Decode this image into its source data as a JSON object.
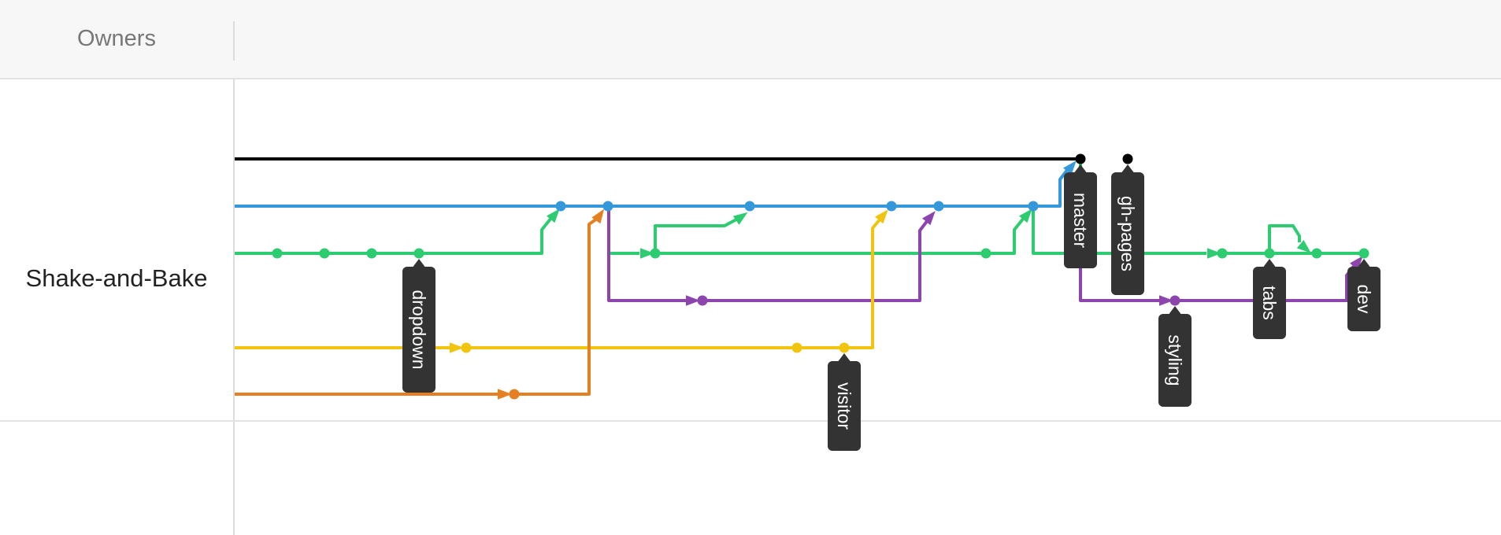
{
  "header": {
    "title": "Owners"
  },
  "repo": {
    "name": "Shake-and-Bake"
  },
  "colors": {
    "black": "#000000",
    "blue": "#3498db",
    "green": "#2ecc71",
    "purple": "#8e44ad",
    "yellow": "#f1c40f",
    "orange": "#e67e22",
    "tag_bg": "#333333"
  },
  "branch_tags": [
    {
      "label": "dropdown",
      "lane": "green"
    },
    {
      "label": "visitor",
      "lane": "yellow"
    },
    {
      "label": "master",
      "lane": "black"
    },
    {
      "label": "gh-pages",
      "lane": "black"
    },
    {
      "label": "styling",
      "lane": "purple"
    },
    {
      "label": "tabs",
      "lane": "green"
    },
    {
      "label": "dev",
      "lane": "green"
    }
  ]
}
